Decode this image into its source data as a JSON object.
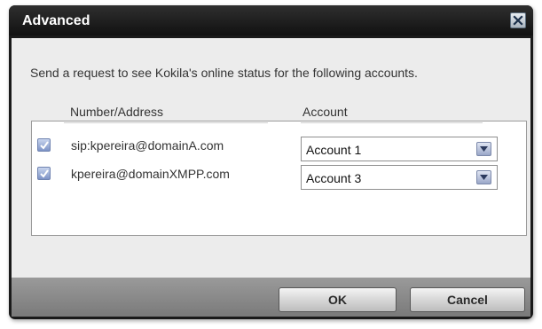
{
  "dialog": {
    "title": "Advanced"
  },
  "instruction": "Send a request to see Kokila's online status for the following accounts.",
  "table": {
    "headers": {
      "number_address": "Number/Address",
      "account": "Account"
    },
    "rows": [
      {
        "checked": true,
        "address": "sip:kpereira@domainA.com",
        "account": "Account 1"
      },
      {
        "checked": true,
        "address": "kpereira@domainXMPP.com",
        "account": "Account 3"
      }
    ]
  },
  "buttons": {
    "ok": "OK",
    "cancel": "Cancel"
  },
  "colors": {
    "titlebar": "#1a1a1a",
    "checkbox": "#7d93c6",
    "panel": "#ececec"
  }
}
